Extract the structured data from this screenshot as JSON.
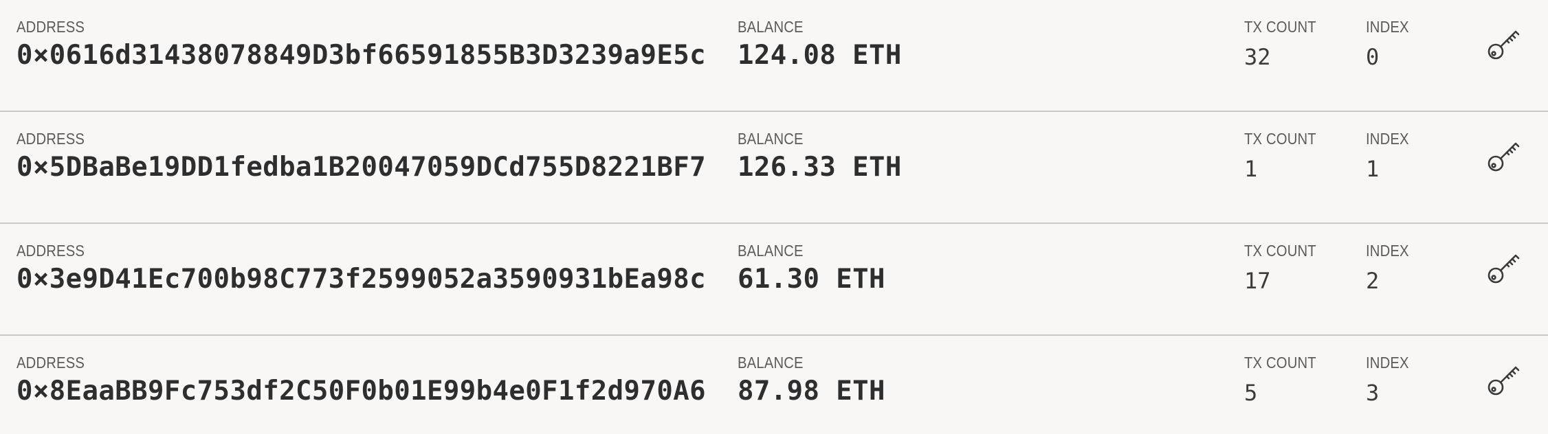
{
  "labels": {
    "address": "ADDRESS",
    "balance": "BALANCE",
    "tx_count": "TX COUNT",
    "index": "INDEX"
  },
  "accounts": [
    {
      "address": "0×0616d31438078849D3bf66591855B3D3239a9E5c",
      "balance": "124.08 ETH",
      "tx_count": "32",
      "index": "0",
      "icon": "key-icon"
    },
    {
      "address": "0×5DBaBe19DD1fedba1B20047059DCd755D8221BF7",
      "balance": "126.33 ETH",
      "tx_count": "1",
      "index": "1",
      "icon": "key-icon"
    },
    {
      "address": "0×3e9D41Ec700b98C773f2599052a3590931bEa98c",
      "balance": "61.30 ETH",
      "tx_count": "17",
      "index": "2",
      "icon": "key-icon"
    },
    {
      "address": "0×8EaaBB9Fc753df2C50F0b01E99b4e0F1f2d970A6",
      "balance": "87.98 ETH",
      "tx_count": "5",
      "index": "3",
      "icon": "key-icon"
    }
  ],
  "colors": {
    "background": "#f8f7f6",
    "divider": "#c9c8c6",
    "label": "#5a5a5a",
    "value": "#2e2e2e"
  }
}
